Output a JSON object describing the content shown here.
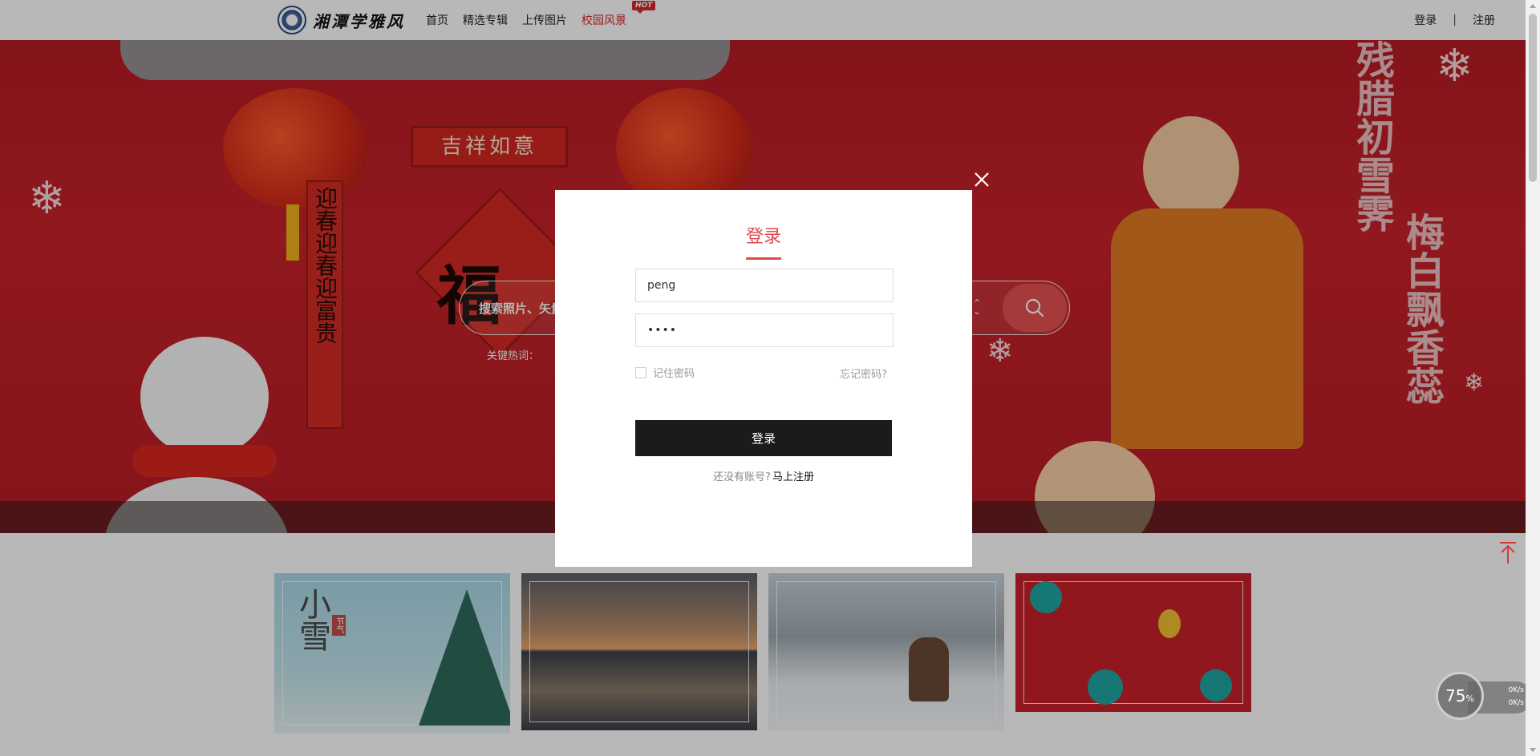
{
  "header": {
    "logo_text": "湘潭学雅风",
    "nav": [
      "首页",
      "精选专辑",
      "上传图片",
      "校园风景"
    ],
    "hot_badge": "HOT",
    "login": "登录",
    "separator": "|",
    "register": "注册"
  },
  "banner": {
    "sign_text": "吉祥如意",
    "fu_char": "福",
    "couplet_text": "迎春迎春迎富贵",
    "poem_right": "梅白飘香蕊",
    "poem_left": "残腊初雪霁",
    "search_placeholder": "搜索照片、矢量图",
    "hot_words_label": "关键热词："
  },
  "gallery": {
    "thumb1_title": "小雪",
    "thumb1_tag": "节气"
  },
  "modal": {
    "title": "登录",
    "username_value": "peng",
    "password_value": "••••",
    "remember_label": "记住密码",
    "forgot_label": "忘记密码?",
    "login_button": "登录",
    "no_account": "还没有账号?",
    "register_link": "马上注册"
  },
  "widget": {
    "percent": "75",
    "percent_unit": "%",
    "up_speed": "0K/s",
    "down_speed": "0K/s"
  },
  "colors": {
    "accent": "#e24a4a",
    "nav_active": "#d8262a",
    "button_dark": "#1b1b1b",
    "banner_red": "#c6202a"
  }
}
